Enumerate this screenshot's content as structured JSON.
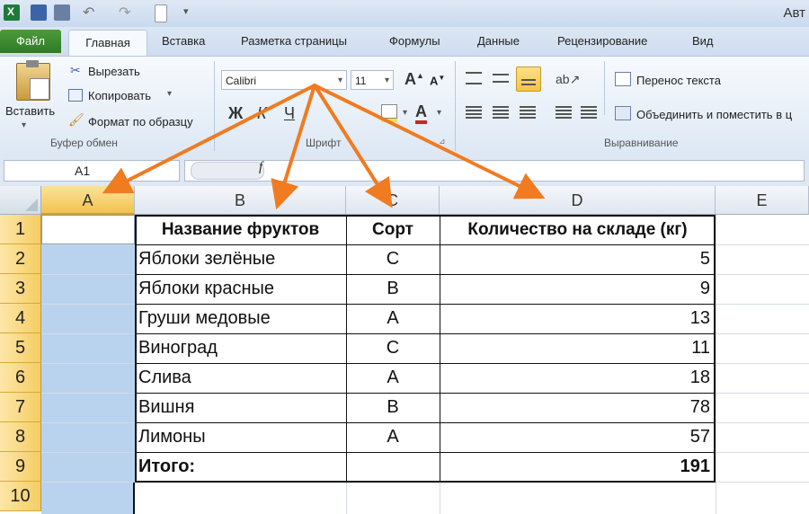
{
  "title_bar": {
    "app_title": "Авт"
  },
  "tabs": [
    {
      "label": "Файл"
    },
    {
      "label": "Главная"
    },
    {
      "label": "Вставка"
    },
    {
      "label": "Разметка страницы"
    },
    {
      "label": "Формулы"
    },
    {
      "label": "Данные"
    },
    {
      "label": "Рецензирование"
    },
    {
      "label": "Вид"
    }
  ],
  "ribbon": {
    "clipboard": {
      "paste_label": "Вставить",
      "cut_label": "Вырезать",
      "copy_label": "Копировать",
      "format_painter_label": "Формат по образцу",
      "group_label": "Буфер обмен"
    },
    "font": {
      "font_name": "Calibri",
      "font_size": "11",
      "bold": "Ж",
      "italic": "К",
      "underline": "Ч",
      "grow": "A",
      "shrink": "A",
      "font_color_glyph": "A",
      "group_label": "Шрифт"
    },
    "alignment": {
      "wrap_text_label": "Перенос текста",
      "merge_label": "Объединить и поместить в ц",
      "group_label": "Выравнивание"
    }
  },
  "formula_bar": {
    "name_box": "A1",
    "fx": "f"
  },
  "columns": [
    {
      "letter": "A"
    },
    {
      "letter": "B"
    },
    {
      "letter": "C"
    },
    {
      "letter": "D"
    },
    {
      "letter": "E"
    }
  ],
  "row_numbers": [
    "1",
    "2",
    "3",
    "4",
    "5",
    "6",
    "7",
    "8",
    "9",
    "10"
  ],
  "table": {
    "headers": [
      "Название фруктов",
      "Сорт",
      "Количество на складе (кг)"
    ],
    "rows": [
      {
        "name": "Яблоки зелёные",
        "sort": "С",
        "qty": "5"
      },
      {
        "name": "Яблоки красные",
        "sort": "В",
        "qty": "9"
      },
      {
        "name": "Груши медовые",
        "sort": "А",
        "qty": "13"
      },
      {
        "name": "Виноград",
        "sort": "С",
        "qty": "11"
      },
      {
        "name": "Слива",
        "sort": "А",
        "qty": "18"
      },
      {
        "name": "Вишня",
        "sort": "В",
        "qty": "78"
      },
      {
        "name": "Лимоны",
        "sort": "А",
        "qty": "57"
      }
    ],
    "total_label": "Итого:",
    "total_value": "191"
  },
  "colors": {
    "arrow": "#f07b21",
    "selection": "#b9d2ee",
    "excel_green": "#2f7a27"
  }
}
